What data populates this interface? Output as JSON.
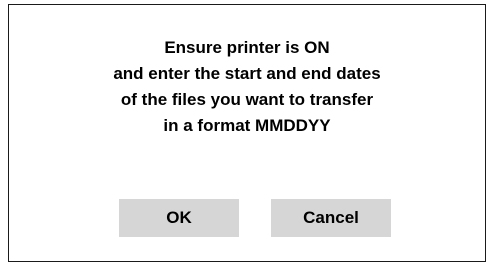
{
  "dialog": {
    "message_lines": [
      "Ensure printer is ON",
      "and enter the start and end dates",
      "of the files you want to transfer",
      "in a format MMDDYY"
    ],
    "ok_label": "OK",
    "cancel_label": "Cancel"
  },
  "colors": {
    "background": "#ffffff",
    "border": "#1a1a1a",
    "button_bg": "#d6d6d6",
    "text": "#000000"
  }
}
